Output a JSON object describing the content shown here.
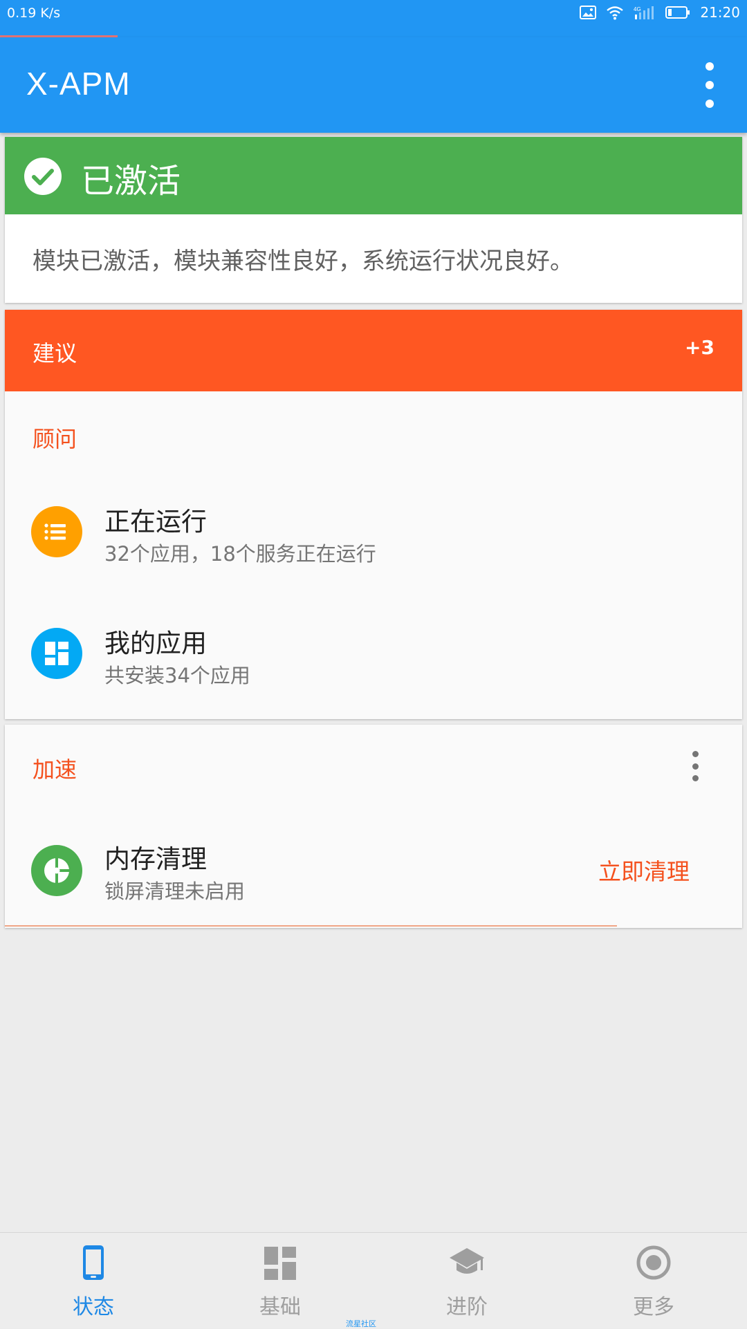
{
  "status_bar": {
    "net_speed": "0.19 K/s",
    "signal_label": "4G",
    "time": "21:20"
  },
  "app_bar": {
    "title": "X-APM",
    "more_icon": "more-vert-icon"
  },
  "status_card": {
    "title": "已激活",
    "description": "模块已激活，模块兼容性良好，系统运行状况良好。",
    "icon": "check-circle-icon",
    "color": "#4CAF50"
  },
  "suggest_card": {
    "title": "建议",
    "count": "+3",
    "color": "#FF5722",
    "section_title": "顾问",
    "items": [
      {
        "title": "正在运行",
        "subtitle": "32个应用，18个服务正在运行",
        "icon": "list-icon",
        "color": "#FFA000"
      },
      {
        "title": "我的应用",
        "subtitle": "共安装34个应用",
        "icon": "dashboard-icon",
        "color": "#03A9F4"
      }
    ]
  },
  "speed_card": {
    "section_title": "加速",
    "item": {
      "title": "内存清理",
      "subtitle": "锁屏清理未启用",
      "icon": "memory-clean-icon",
      "color": "#4CAF50"
    },
    "action": "立即清理"
  },
  "bottom_nav": {
    "items": [
      {
        "label": "状态",
        "icon": "phone-icon",
        "active": true
      },
      {
        "label": "基础",
        "icon": "dashboard-icon",
        "active": false
      },
      {
        "label": "进阶",
        "icon": "school-icon",
        "active": false
      },
      {
        "label": "更多",
        "icon": "radio-button-icon",
        "active": false
      }
    ]
  },
  "watermark": "流星社区",
  "colors": {
    "primary": "#2196F3",
    "accent": "#F4511E"
  }
}
